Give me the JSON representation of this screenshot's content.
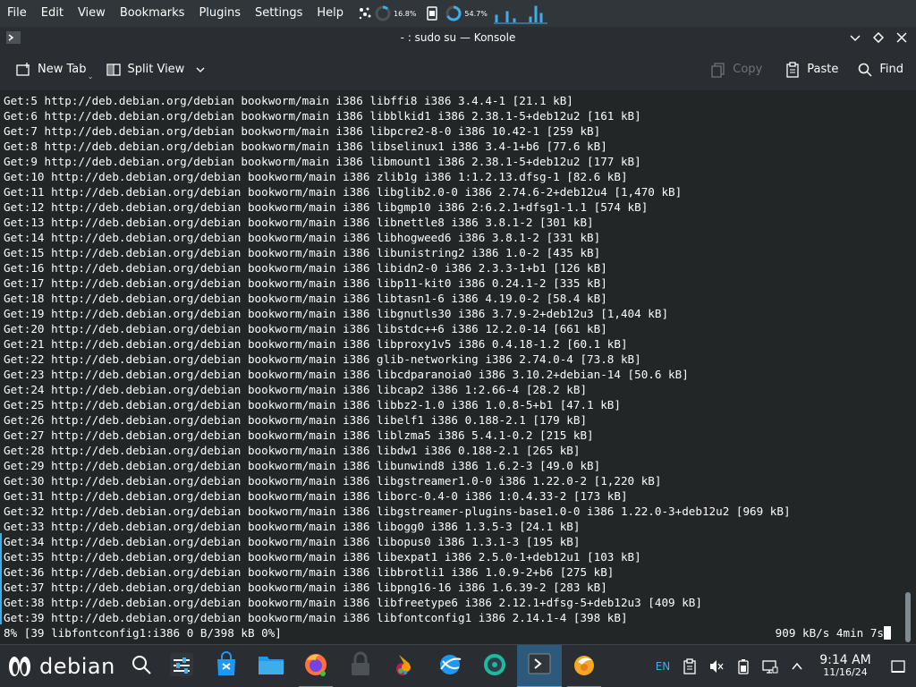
{
  "menubar": {
    "items": [
      "File",
      "Edit",
      "View",
      "Bookmarks",
      "Plugins",
      "Settings",
      "Help"
    ],
    "cpu_label": "16.8%",
    "mem_label": "54.7%"
  },
  "window": {
    "title": "- : sudo su — Konsole"
  },
  "toolbar": {
    "new_tab": "New Tab",
    "split_view": "Split View",
    "copy": "Copy",
    "paste": "Paste",
    "find": "Find"
  },
  "terminal": {
    "lines": [
      "Get:5 http://deb.debian.org/debian bookworm/main i386 libffi8 i386 3.4.4-1 [21.1 kB]",
      "Get:6 http://deb.debian.org/debian bookworm/main i386 libblkid1 i386 2.38.1-5+deb12u2 [161 kB]",
      "Get:7 http://deb.debian.org/debian bookworm/main i386 libpcre2-8-0 i386 10.42-1 [259 kB]",
      "Get:8 http://deb.debian.org/debian bookworm/main i386 libselinux1 i386 3.4-1+b6 [77.6 kB]",
      "Get:9 http://deb.debian.org/debian bookworm/main i386 libmount1 i386 2.38.1-5+deb12u2 [177 kB]",
      "Get:10 http://deb.debian.org/debian bookworm/main i386 zlib1g i386 1:1.2.13.dfsg-1 [82.6 kB]",
      "Get:11 http://deb.debian.org/debian bookworm/main i386 libglib2.0-0 i386 2.74.6-2+deb12u4 [1,470 kB]",
      "Get:12 http://deb.debian.org/debian bookworm/main i386 libgmp10 i386 2:6.2.1+dfsg1-1.1 [574 kB]",
      "Get:13 http://deb.debian.org/debian bookworm/main i386 libnettle8 i386 3.8.1-2 [301 kB]",
      "Get:14 http://deb.debian.org/debian bookworm/main i386 libhogweed6 i386 3.8.1-2 [331 kB]",
      "Get:15 http://deb.debian.org/debian bookworm/main i386 libunistring2 i386 1.0-2 [435 kB]",
      "Get:16 http://deb.debian.org/debian bookworm/main i386 libidn2-0 i386 2.3.3-1+b1 [126 kB]",
      "Get:17 http://deb.debian.org/debian bookworm/main i386 libp11-kit0 i386 0.24.1-2 [335 kB]",
      "Get:18 http://deb.debian.org/debian bookworm/main i386 libtasn1-6 i386 4.19.0-2 [58.4 kB]",
      "Get:19 http://deb.debian.org/debian bookworm/main i386 libgnutls30 i386 3.7.9-2+deb12u3 [1,404 kB]",
      "Get:20 http://deb.debian.org/debian bookworm/main i386 libstdc++6 i386 12.2.0-14 [661 kB]",
      "Get:21 http://deb.debian.org/debian bookworm/main i386 libproxy1v5 i386 0.4.18-1.2 [60.1 kB]",
      "Get:22 http://deb.debian.org/debian bookworm/main i386 glib-networking i386 2.74.0-4 [73.8 kB]",
      "Get:23 http://deb.debian.org/debian bookworm/main i386 libcdparanoia0 i386 3.10.2+debian-14 [50.6 kB]",
      "Get:24 http://deb.debian.org/debian bookworm/main i386 libcap2 i386 1:2.66-4 [28.2 kB]",
      "Get:25 http://deb.debian.org/debian bookworm/main i386 libbz2-1.0 i386 1.0.8-5+b1 [47.1 kB]",
      "Get:26 http://deb.debian.org/debian bookworm/main i386 libelf1 i386 0.188-2.1 [179 kB]",
      "Get:27 http://deb.debian.org/debian bookworm/main i386 liblzma5 i386 5.4.1-0.2 [215 kB]",
      "Get:28 http://deb.debian.org/debian bookworm/main i386 libdw1 i386 0.188-2.1 [265 kB]",
      "Get:29 http://deb.debian.org/debian bookworm/main i386 libunwind8 i386 1.6.2-3 [49.0 kB]",
      "Get:30 http://deb.debian.org/debian bookworm/main i386 libgstreamer1.0-0 i386 1.22.0-2 [1,220 kB]",
      "Get:31 http://deb.debian.org/debian bookworm/main i386 liborc-0.4-0 i386 1:0.4.33-2 [173 kB]",
      "Get:32 http://deb.debian.org/debian bookworm/main i386 libgstreamer-plugins-base1.0-0 i386 1.22.0-3+deb12u2 [969 kB]",
      "Get:33 http://deb.debian.org/debian bookworm/main i386 libogg0 i386 1.3.5-3 [24.1 kB]",
      "Get:34 http://deb.debian.org/debian bookworm/main i386 libopus0 i386 1.3.1-3 [195 kB]",
      "Get:35 http://deb.debian.org/debian bookworm/main i386 libexpat1 i386 2.5.0-1+deb12u1 [103 kB]",
      "Get:36 http://deb.debian.org/debian bookworm/main i386 libbrotli1 i386 1.0.9-2+b6 [275 kB]",
      "Get:37 http://deb.debian.org/debian bookworm/main i386 libpng16-16 i386 1.6.39-2 [283 kB]",
      "Get:38 http://deb.debian.org/debian bookworm/main i386 libfreetype6 i386 2.12.1+dfsg-5+deb12u3 [409 kB]",
      "Get:39 http://deb.debian.org/debian bookworm/main i386 libfontconfig1 i386 2.14.1-4 [398 kB]"
    ],
    "progress_left": "8% [39 libfontconfig1:i386 0 B/398 kB 0%]",
    "progress_right": "909 kB/s 4min 7s"
  },
  "taskbar": {
    "start_label": "debian",
    "language": "EN",
    "time": "9:14 AM",
    "date": "11/16/24"
  },
  "colors": {
    "accent": "#3daee9",
    "terminal_bg": "#232627",
    "panel_bg": "#2a2e32"
  }
}
